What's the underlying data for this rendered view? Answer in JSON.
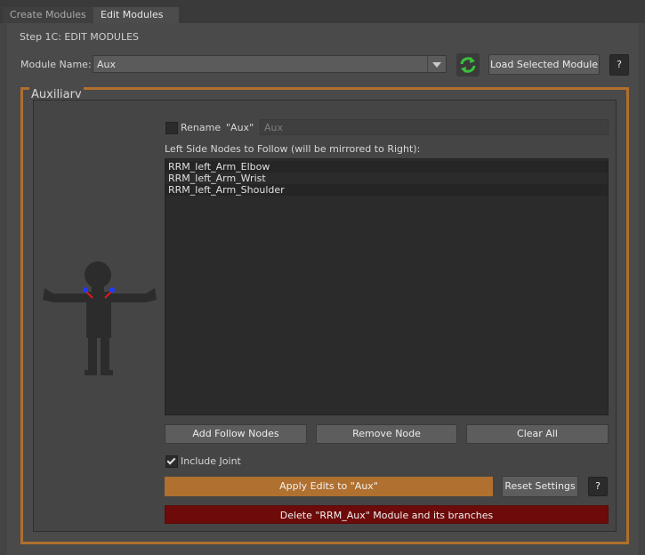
{
  "tabs": [
    {
      "label": "Create Modules",
      "active": false
    },
    {
      "label": "Edit Modules",
      "active": true
    }
  ],
  "step_title": "Step 1C: EDIT MODULES",
  "module_row": {
    "label": "Module Name:",
    "selected": "Aux",
    "refresh_icon": "refresh-icon",
    "load_button": "Load Selected Module",
    "help_button": "?"
  },
  "group": {
    "title": "Auxiliary",
    "rename": {
      "label": "Rename",
      "current": "\"Aux\"",
      "value": "Aux",
      "checked": false
    },
    "list_label": "Left Side Nodes to Follow (will be mirrored to Right):",
    "nodes": [
      "RRM_left_Arm_Elbow",
      "RRM_left_Arm_Wrist",
      "RRM_left_Arm_Shoulder"
    ],
    "buttons": {
      "add": "Add Follow Nodes",
      "remove": "Remove Node",
      "clear": "Clear All"
    },
    "include_joint": {
      "label": "Include Joint",
      "checked": true
    },
    "apply_button": "Apply Edits to \"Aux\"",
    "reset_button": "Reset Settings",
    "help_button": "?",
    "delete_button": "Delete \"RRM_Aux\" Module and its branches"
  },
  "colors": {
    "accent": "#b06f2d",
    "danger": "#6d0a0a",
    "refresh": "#3cbf3c"
  }
}
